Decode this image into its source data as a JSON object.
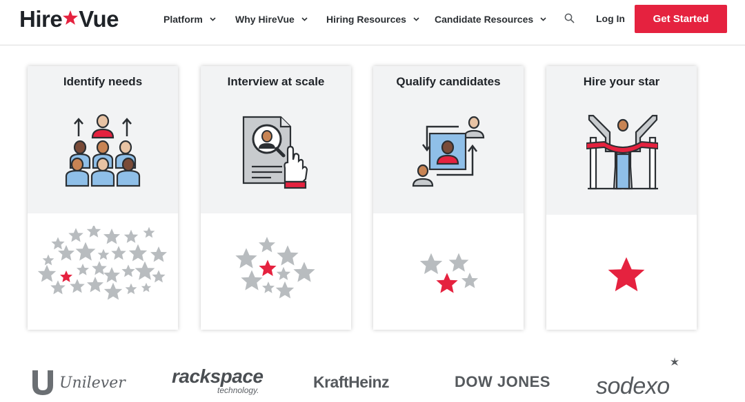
{
  "header": {
    "logo_left": "Hire",
    "logo_right": "Vue",
    "nav": [
      {
        "label": "Platform"
      },
      {
        "label": "Why HireVue"
      },
      {
        "label": "Hiring Resources"
      },
      {
        "label": "Candidate Resources"
      }
    ],
    "login_label": "Log In",
    "cta_label": "Get Started"
  },
  "cards": [
    {
      "title": "Identify needs",
      "illustration": "team-hierarchy-icon",
      "star_density": "many"
    },
    {
      "title": "Interview at scale",
      "illustration": "document-magnifier-icon",
      "star_density": "some"
    },
    {
      "title": "Qualify candidates",
      "illustration": "candidate-exchange-icon",
      "star_density": "few"
    },
    {
      "title": "Hire your star",
      "illustration": "finish-line-winner-icon",
      "star_density": "one"
    }
  ],
  "logos": {
    "unilever": "Unilever",
    "rackspace": "rackspace",
    "rackspace_sub": "technology.",
    "kraftheinz": "KraftHeinz",
    "dowjones": "DOW JONES",
    "sodexo": "sodexo"
  },
  "colors": {
    "brand_red": "#e5223f",
    "card_top_bg": "#f2f3f4",
    "star_gray": "#b8bcbf",
    "icon_blue": "#8fbfe8",
    "skin": "#e8c3a4",
    "text_dark": "#1f2328"
  }
}
